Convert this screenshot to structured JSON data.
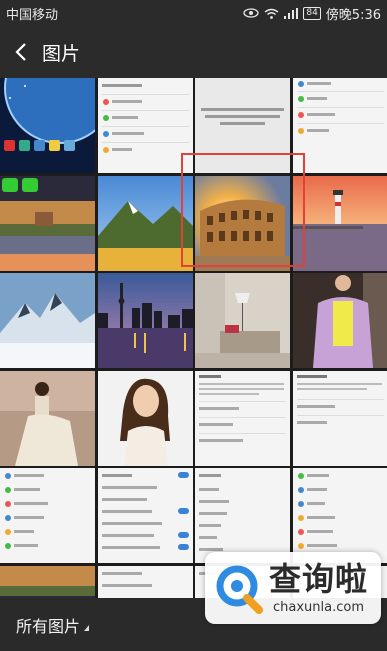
{
  "status_bar": {
    "carrier": "中国移动",
    "battery": "84",
    "time": "傍晚5:36",
    "icons": [
      "eye-icon",
      "wifi-icon",
      "signal-icon",
      "battery-icon"
    ]
  },
  "header": {
    "title": "图片",
    "back_icon": "chevron-left-icon"
  },
  "footer": {
    "album_label": "所有图片"
  },
  "watermark": {
    "brand": "查询啦",
    "domain": "chaxunla.com"
  },
  "tiles": [
    "earth-home-screenshot",
    "settings-screenshot",
    "settings-screenshot",
    "settings-screenshot",
    "wechat-home-screenshot",
    "mountain-lake-photo",
    "colosseum-photo",
    "lighthouse-photo",
    "snowy-mountain-photo",
    "city-skyline-photo",
    "living-room-photo",
    "fashion-dress-photo",
    "woman-dress-photo",
    "woman-portrait-photo",
    "settings-screenshot",
    "settings-screenshot",
    "settings-screenshot",
    "settings-screenshot",
    "settings-screenshot",
    "settings-screenshot",
    "home-screen-screenshot",
    "settings-screenshot",
    "settings-screenshot",
    "settings-screenshot"
  ],
  "selected_tile": "colosseum-photo"
}
